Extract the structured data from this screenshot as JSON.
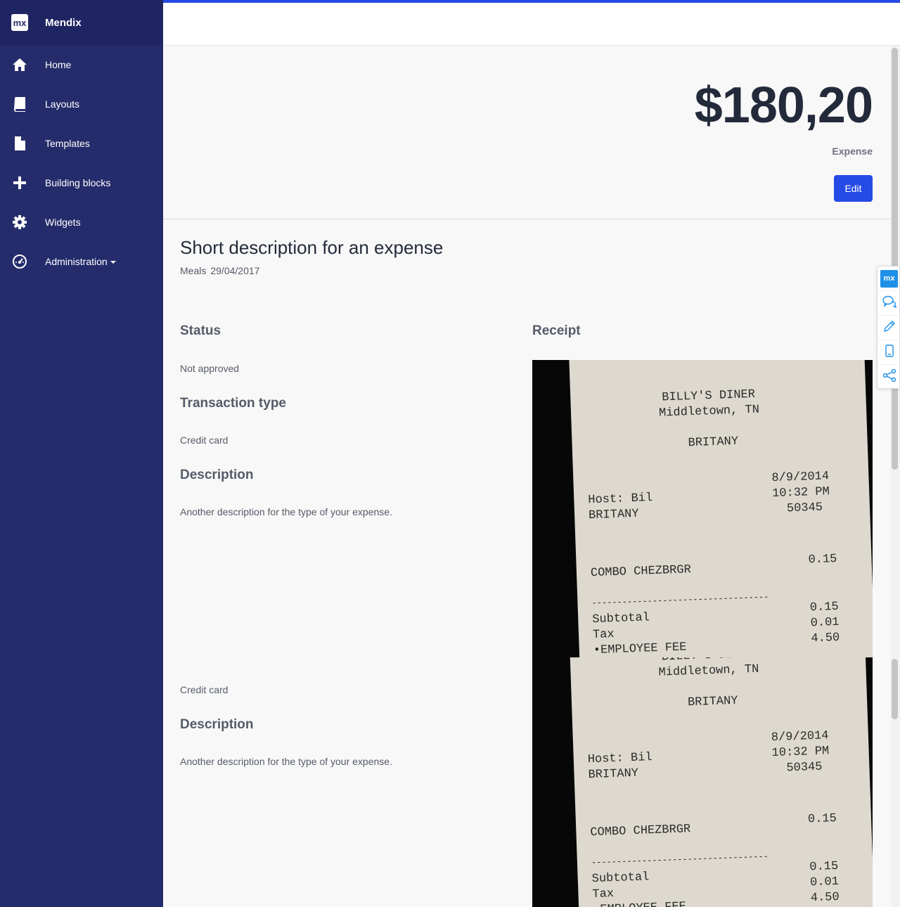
{
  "brand": {
    "logo": "mx",
    "name": "Mendix"
  },
  "nav": [
    {
      "label": "Home",
      "icon": "home-icon"
    },
    {
      "label": "Layouts",
      "icon": "book-icon"
    },
    {
      "label": "Templates",
      "icon": "file-icon"
    },
    {
      "label": "Building blocks",
      "icon": "plus-icon"
    },
    {
      "label": "Widgets",
      "icon": "gear-icon"
    },
    {
      "label": "Administration",
      "icon": "dashboard-icon"
    }
  ],
  "header": {
    "amount": "$180,20",
    "amount_label": "Expense",
    "edit_label": "Edit"
  },
  "expense": {
    "title": "Short description for an expense",
    "category": "Meals",
    "date": "29/04/2017"
  },
  "details": {
    "status_label": "Status",
    "status_value": "Not approved",
    "transaction_label": "Transaction type",
    "transaction_value": "Credit card",
    "description_label": "Description",
    "description_value": "Another description for the type of your expense.",
    "receipt_label": "Receipt"
  },
  "receipt": {
    "header1": "BILLY'S DINER",
    "header2": "Middletown, TN",
    "server": "BRITANY",
    "host": "Host: Bil",
    "host_name": "BRITANY",
    "date": "8/9/2014",
    "time": "10:32 PM",
    "check": "50345",
    "item": "COMBO CHEZBRGR",
    "item_price": "0.15",
    "divider": "-----------------------------------",
    "subtotal_label": "Subtotal",
    "subtotal": "0.15",
    "tax_label": "Tax",
    "tax": "0.01",
    "fee_label": "•EMPLOYEE FEE",
    "fee": "4.50"
  },
  "toolbar": {
    "logo": "mx"
  },
  "colors": {
    "sidebar": "#252c6b",
    "brand_bar": "#1f2562",
    "accent": "#264ae5",
    "text_dark": "#232a3a",
    "text_muted": "#555b68"
  }
}
